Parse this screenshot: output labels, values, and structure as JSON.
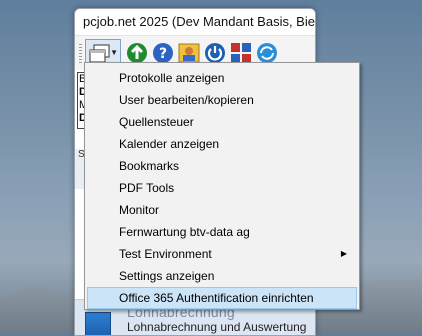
{
  "window": {
    "title": "pcjob.net 2025 (Dev Mandant Basis, Biel/..."
  },
  "toolbar": {
    "icons": [
      "window-dropdown-icon",
      "refresh-icon",
      "help-icon",
      "user-icon",
      "power-icon",
      "grid-icon",
      "sync-icon"
    ]
  },
  "left_panel": {
    "line1": "B",
    "line2": "D",
    "line3": "M",
    "line4": "D",
    "strip": "S"
  },
  "menu": {
    "items": [
      {
        "label": "Protokolle anzeigen",
        "submenu": false
      },
      {
        "label": "User bearbeiten/kopieren",
        "submenu": false
      },
      {
        "label": "Quellensteuer",
        "submenu": false
      },
      {
        "label": "Kalender anzeigen",
        "submenu": false
      },
      {
        "label": "Bookmarks",
        "submenu": false
      },
      {
        "label": "PDF Tools",
        "submenu": false
      },
      {
        "label": "Monitor",
        "submenu": false
      },
      {
        "label": "Fernwartung btv-data ag",
        "submenu": false
      },
      {
        "label": "Test Environment",
        "submenu": true
      },
      {
        "label": "Settings anzeigen",
        "submenu": false
      },
      {
        "label": "Office 365 Authentification einrichten",
        "submenu": false,
        "highlighted": true
      }
    ]
  },
  "bottom_item": {
    "heading": "Lohnabrechnung",
    "subtitle": "Lohnabrechnung und Auswertung"
  }
}
